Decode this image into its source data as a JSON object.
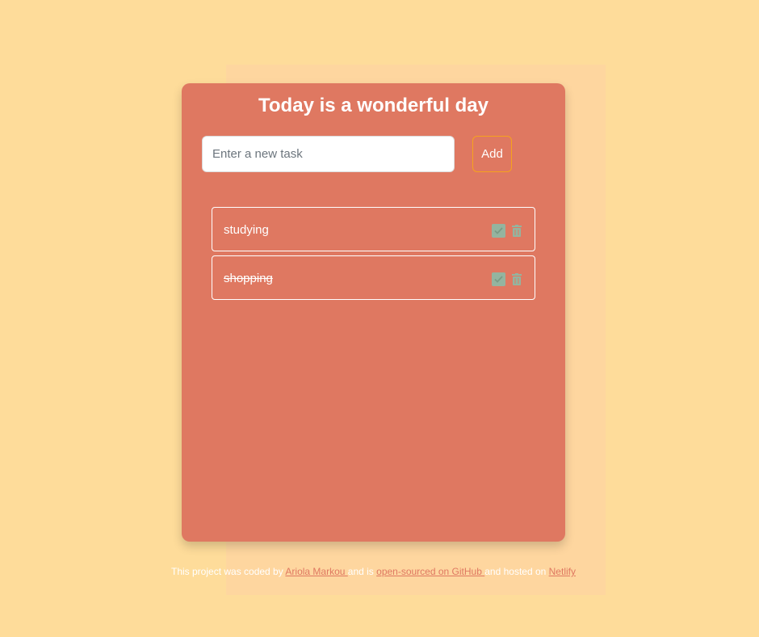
{
  "app": {
    "title": "Today is a wonderful day"
  },
  "new_task": {
    "placeholder": "Enter a new task",
    "value": "",
    "add_label": "Add"
  },
  "tasks": [
    {
      "text": "studying",
      "completed": false,
      "check_icon": "check-icon",
      "delete_icon": "trash-icon"
    },
    {
      "text": "shopping",
      "completed": true,
      "check_icon": "check-icon",
      "delete_icon": "trash-icon"
    }
  ],
  "footer": {
    "text_before": "This project was coded by ",
    "author_link": "Ariola Markou ",
    "text_middle": " and is ",
    "github_link": "open-sourced on GitHub ",
    "text_after": " and hosted on ",
    "netlify_link": "Netlify"
  },
  "colors": {
    "page_background": "#fedc9a",
    "card_background": "#df7861",
    "accent_border": "#f6a21e",
    "check_color": "#94b49f",
    "link_color": "#df7861"
  }
}
